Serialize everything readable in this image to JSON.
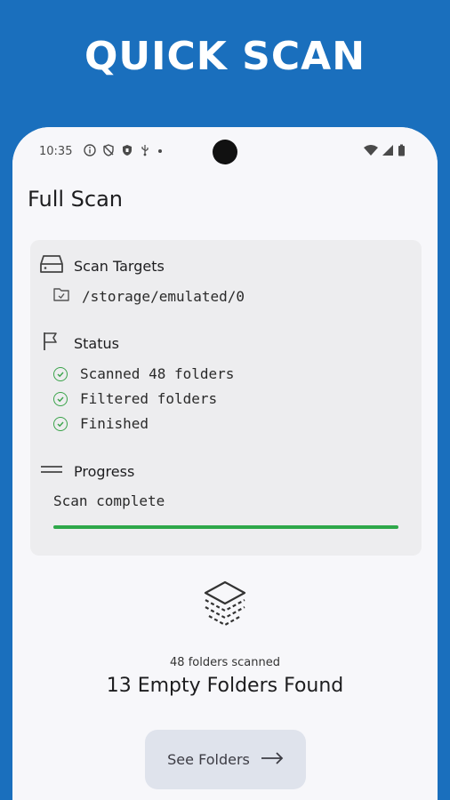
{
  "banner": {
    "title": "QUICK SCAN"
  },
  "status_bar": {
    "time": "10:35"
  },
  "app_bar": {
    "title": "Full Scan"
  },
  "scan_targets": {
    "heading": "Scan Targets",
    "items": [
      "/storage/emulated/0"
    ]
  },
  "status": {
    "heading": "Status",
    "items": [
      "Scanned 48 folders",
      "Filtered folders",
      "Finished"
    ]
  },
  "progress": {
    "heading": "Progress",
    "text": "Scan complete",
    "fraction": 1.0
  },
  "result": {
    "subtitle": "48 folders scanned",
    "headline": "13 Empty Folders Found"
  },
  "actions": {
    "see_folders_label": "See Folders"
  },
  "colors": {
    "background": "#1a6fbd",
    "card": "#ededef",
    "success": "#2ea84a",
    "button": "#dfe3ec"
  }
}
